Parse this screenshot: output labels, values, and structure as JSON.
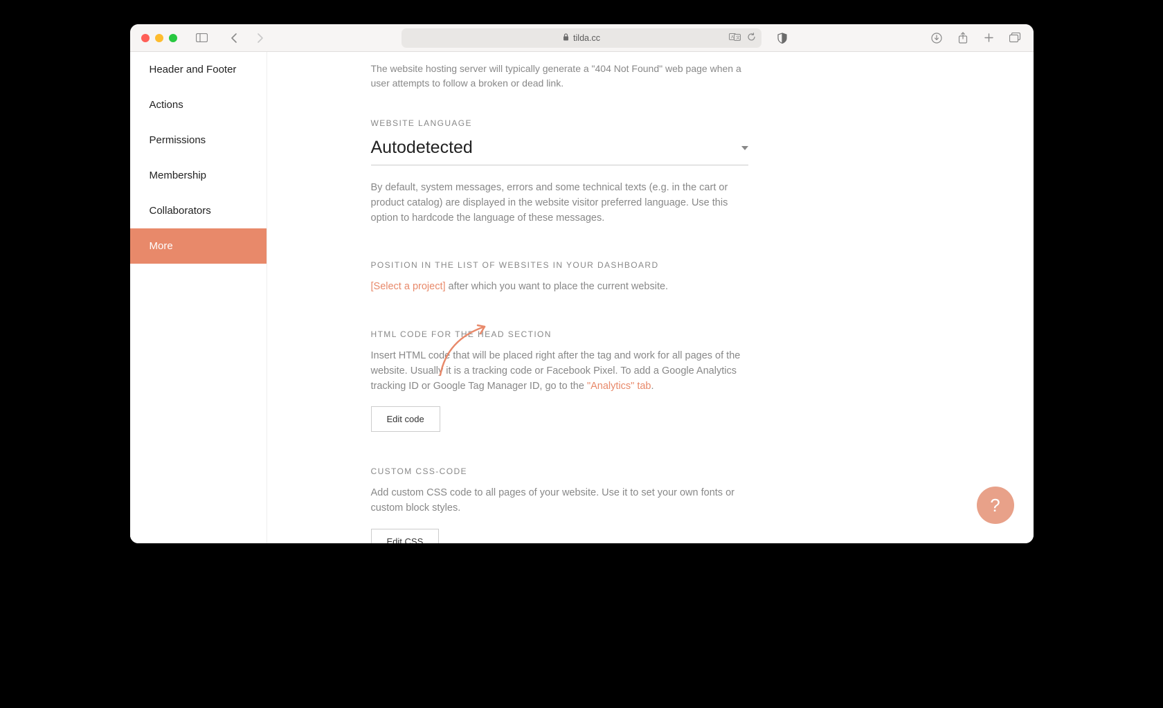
{
  "browser": {
    "url_host": "tilda.cc"
  },
  "sidebar": {
    "items": [
      {
        "label": "Header and Footer"
      },
      {
        "label": "Actions"
      },
      {
        "label": "Permissions"
      },
      {
        "label": "Membership"
      },
      {
        "label": "Collaborators"
      },
      {
        "label": "More"
      }
    ],
    "active_index": 5
  },
  "sections": {
    "notFound": {
      "desc": "The website hosting server will typically generate a \"404 Not Found\" web page when a user attempts to follow a broken or dead link."
    },
    "language": {
      "label": "WEBSITE LANGUAGE",
      "value": "Autodetected",
      "desc": "By default, system messages, errors and some technical texts (e.g. in the cart or product catalog) are displayed in the website visitor preferred language. Use this option to hardcode the language of these messages."
    },
    "position": {
      "label": "POSITION IN THE LIST OF WEBSITES IN YOUR DASHBOARD",
      "link": "[Select a project]",
      "rest": " after which you want to place the current website."
    },
    "head": {
      "label": "HTML CODE FOR THE HEAD SECTION",
      "desc_pre": "Insert HTML code that will be placed right after the tag and work for all pages of the website. Usually it is a tracking code or Facebook Pixel. To add a Google Analytics tracking ID or Google Tag Manager ID, go to the ",
      "link": "\"Analytics\" tab",
      "desc_post": ".",
      "button": "Edit code"
    },
    "css": {
      "label": "CUSTOM CSS-CODE",
      "desc": "Add custom CSS code to all pages of your website. Use it to set your own fonts or custom block styles.",
      "button": "Edit CSS"
    }
  },
  "help": "?"
}
